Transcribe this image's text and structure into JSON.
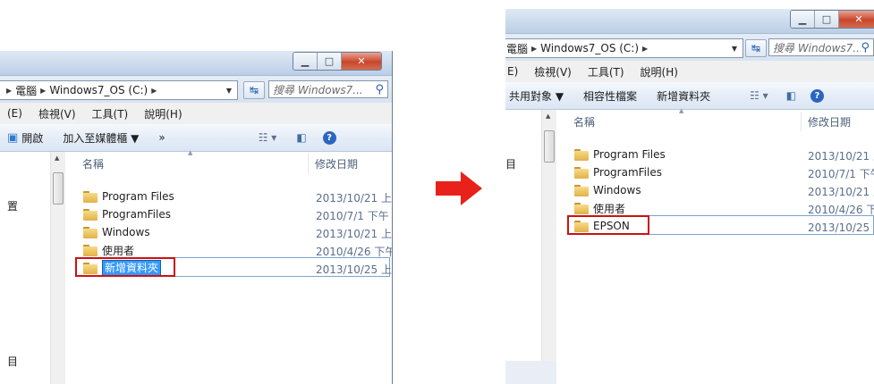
{
  "left": {
    "address": {
      "computer": "電腦",
      "drive": "Windows7_OS (C:)"
    },
    "search_placeholder": "搜尋 Windows7...",
    "menu": [
      "(E)",
      "檢視(V)",
      "工具(T)",
      "說明(H)"
    ],
    "toolbar": {
      "open": "開啟",
      "add_media": "加入至媒體櫃 ▼",
      "more": "»"
    },
    "nav_text": [
      "置",
      "目"
    ],
    "columns": {
      "name": "名稱",
      "date": "修改日期"
    },
    "files": [
      {
        "name": "Program Files",
        "date": "2013/10/21 上"
      },
      {
        "name": "ProgramFiles",
        "date": "2010/7/1 下午"
      },
      {
        "name": "Windows",
        "date": "2013/10/21 上"
      },
      {
        "name": "使用者",
        "date": "2010/4/26 下午"
      }
    ],
    "new_folder": {
      "name": "新增資料夾",
      "date": "2013/10/25 上"
    }
  },
  "right": {
    "address": {
      "computer": "電腦",
      "drive": "Windows7_OS (C:)"
    },
    "search_placeholder": "搜尋 Windows7...",
    "menu": [
      "E)",
      "檢視(V)",
      "工具(T)",
      "說明(H)"
    ],
    "toolbar": {
      "share": "共用對象 ▼",
      "compat": "相容性檔案",
      "new_folder": "新增資料夾"
    },
    "nav_text": [
      "目"
    ],
    "columns": {
      "name": "名稱",
      "date": "修改日期"
    },
    "files": [
      {
        "name": "Program Files",
        "date": "2013/10/21 上"
      },
      {
        "name": "ProgramFiles",
        "date": "2010/7/1 下午"
      },
      {
        "name": "Windows",
        "date": "2013/10/21 上"
      },
      {
        "name": "使用者",
        "date": "2010/4/26 下"
      }
    ],
    "renamed_folder": {
      "name": "EPSON",
      "date": "2013/10/25 上"
    }
  },
  "colors": {
    "highlight": "#cc1111",
    "arrow": "#e8211a",
    "selection": "#3399ff"
  },
  "icons": [
    "folder-icon",
    "refresh-icon",
    "search-icon",
    "help-icon",
    "view-icon",
    "preview-pane-icon",
    "right-arrow-icon"
  ]
}
